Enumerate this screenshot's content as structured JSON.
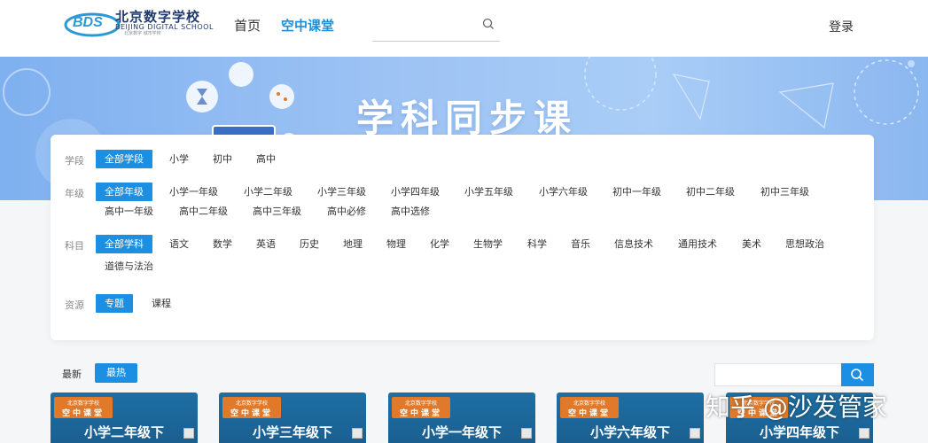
{
  "header": {
    "logo": {
      "name": "北京数字学校",
      "en": "BEIJING DIGITAL SCHOOL",
      "small": "北京数字 城市学校"
    },
    "nav": [
      {
        "label": "首页"
      },
      {
        "label": "空中课堂"
      }
    ],
    "login": "登录"
  },
  "banner": {
    "title": "学科同步课"
  },
  "filters": {
    "stage": {
      "label": "学段",
      "options": [
        "全部学段",
        "小学",
        "初中",
        "高中"
      ]
    },
    "grade": {
      "label": "年级",
      "options": [
        "全部年级",
        "小学一年级",
        "小学二年级",
        "小学三年级",
        "小学四年级",
        "小学五年级",
        "小学六年级",
        "初中一年级",
        "初中二年级",
        "初中三年级",
        "高中一年级",
        "高中二年级",
        "高中三年级",
        "高中必修",
        "高中选修"
      ]
    },
    "subject": {
      "label": "科目",
      "options": [
        "全部学科",
        "语文",
        "数学",
        "英语",
        "历史",
        "地理",
        "物理",
        "化学",
        "生物学",
        "科学",
        "音乐",
        "信息技术",
        "通用技术",
        "美术",
        "思想政治",
        "道德与法治"
      ]
    },
    "resource": {
      "label": "资源",
      "options": [
        "专题",
        "课程"
      ]
    }
  },
  "toolbar": {
    "latest": "最新",
    "hottest": "最热"
  },
  "cards": [
    {
      "badge_top": "北京数字学校",
      "badge": "空中课堂",
      "title": "小学二年级下"
    },
    {
      "badge_top": "北京数字学校",
      "badge": "空中课堂",
      "title": "小学三年级下"
    },
    {
      "badge_top": "北京数字学校",
      "badge": "空中课堂",
      "title": "小学一年级下"
    },
    {
      "badge_top": "北京数字学校",
      "badge": "空中课堂",
      "title": "小学六年级下"
    },
    {
      "badge_top": "北京数字学校",
      "badge": "空中课堂",
      "title": "小学四年级下"
    }
  ],
  "watermark": "知乎 @沙发管家",
  "colors": {
    "accent": "#1d8fe3",
    "nav_active": "#1e90d8",
    "badge": "#e07a2a",
    "card_bg": "#1d6fa4"
  }
}
